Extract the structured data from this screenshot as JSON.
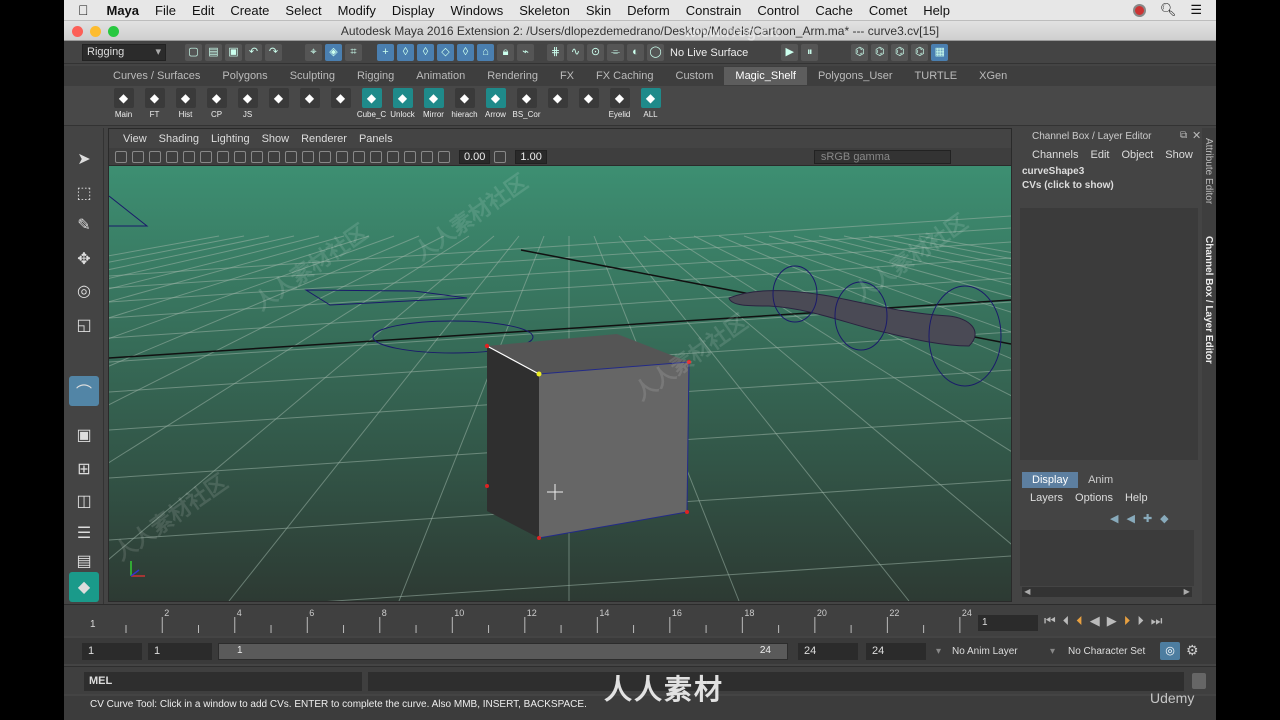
{
  "menubar": {
    "apple": "",
    "app": "Maya",
    "items": [
      "File",
      "Edit",
      "Create",
      "Select",
      "Modify",
      "Display",
      "Windows",
      "Skeleton",
      "Skin",
      "Deform",
      "Constrain",
      "Control",
      "Cache",
      "Comet",
      "Help"
    ]
  },
  "window_title": "Autodesk Maya 2016 Extension 2: /Users/dlopezdemedrano/Desktop/Models/Cartoon_Arm.ma*   ---   curve3.cv[15]",
  "status_line": {
    "menu_set": "Rigging",
    "live_surface": "No Live Surface"
  },
  "shelf_tabs": [
    "Curves / Surfaces",
    "Polygons",
    "Sculpting",
    "Rigging",
    "Animation",
    "Rendering",
    "FX",
    "FX Caching",
    "Custom",
    "Magic_Shelf",
    "Polygons_User",
    "TURTLE",
    "XGen"
  ],
  "active_shelf_tab": "Magic_Shelf",
  "shelf_buttons": [
    {
      "label": "Main",
      "color": "#3a3a3a"
    },
    {
      "label": "FT",
      "color": "#3a3a3a"
    },
    {
      "label": "Hist",
      "color": "#3a3a3a"
    },
    {
      "label": "CP",
      "color": "#3a3a3a"
    },
    {
      "label": "JS",
      "color": "#3a3a3a"
    },
    {
      "label": "",
      "color": "#3a3a3a"
    },
    {
      "label": "",
      "color": "#3a3a3a"
    },
    {
      "label": "",
      "color": "#3a3a3a"
    },
    {
      "label": "Cube_C",
      "color": "#1f8a8a"
    },
    {
      "label": "Unlock",
      "color": "#1f8a8a"
    },
    {
      "label": "Mirror",
      "color": "#1f8a8a"
    },
    {
      "label": "hierach",
      "color": "#3a3a3a"
    },
    {
      "label": "Arrow",
      "color": "#1f8a8a"
    },
    {
      "label": "BS_Cor",
      "color": "#3a3a3a"
    },
    {
      "label": "",
      "color": "#3a3a3a"
    },
    {
      "label": "",
      "color": "#3a3a3a"
    },
    {
      "label": "Eyelid",
      "color": "#3a3a3a"
    },
    {
      "label": "ALL",
      "color": "#1f8a8a"
    }
  ],
  "viewport": {
    "menus": [
      "View",
      "Shading",
      "Lighting",
      "Show",
      "Renderer",
      "Panels"
    ],
    "near_value": "0.00",
    "far_value": "1.00",
    "color_space": "sRGB gamma"
  },
  "channel_box": {
    "title": "Channel Box / Layer Editor",
    "menus": [
      "Channels",
      "Edit",
      "Object",
      "Show"
    ],
    "shape": "curveShape3",
    "cvs": "CVs (click to show)"
  },
  "layer_editor": {
    "tabs": [
      "Display",
      "Anim"
    ],
    "active_tab": "Display",
    "menus": [
      "Layers",
      "Options",
      "Help"
    ]
  },
  "side_tabs": [
    "Attribute Editor",
    "Channel Box / Layer Editor"
  ],
  "timeline": {
    "ticks": [
      "2",
      "4",
      "6",
      "8",
      "10",
      "12",
      "14",
      "16",
      "18",
      "20",
      "22",
      "24"
    ],
    "start_label": "1",
    "current_frame": "1"
  },
  "range": {
    "start": "1",
    "inner_start": "1",
    "slider_start": "1",
    "slider_end": "24",
    "end": "24",
    "anim_end": "24",
    "anim_layer": "No Anim Layer",
    "character_set": "No Character Set"
  },
  "mel": {
    "label": "MEL"
  },
  "help_line": "CV Curve Tool: Click in a window to add CVs. ENTER to complete the curve. Also MMB, INSERT, BACKSPACE.",
  "watermarks": {
    "site": "www.rrcg.cn",
    "logo_text": "人人素材",
    "side": "人人素材社区",
    "brand": "Udemy"
  },
  "colors": {
    "viewport_top": "#3d8f72",
    "viewport_bottom": "#2d3a33",
    "accent": "#5285a6",
    "cv_curve": "#1a1a6a"
  }
}
